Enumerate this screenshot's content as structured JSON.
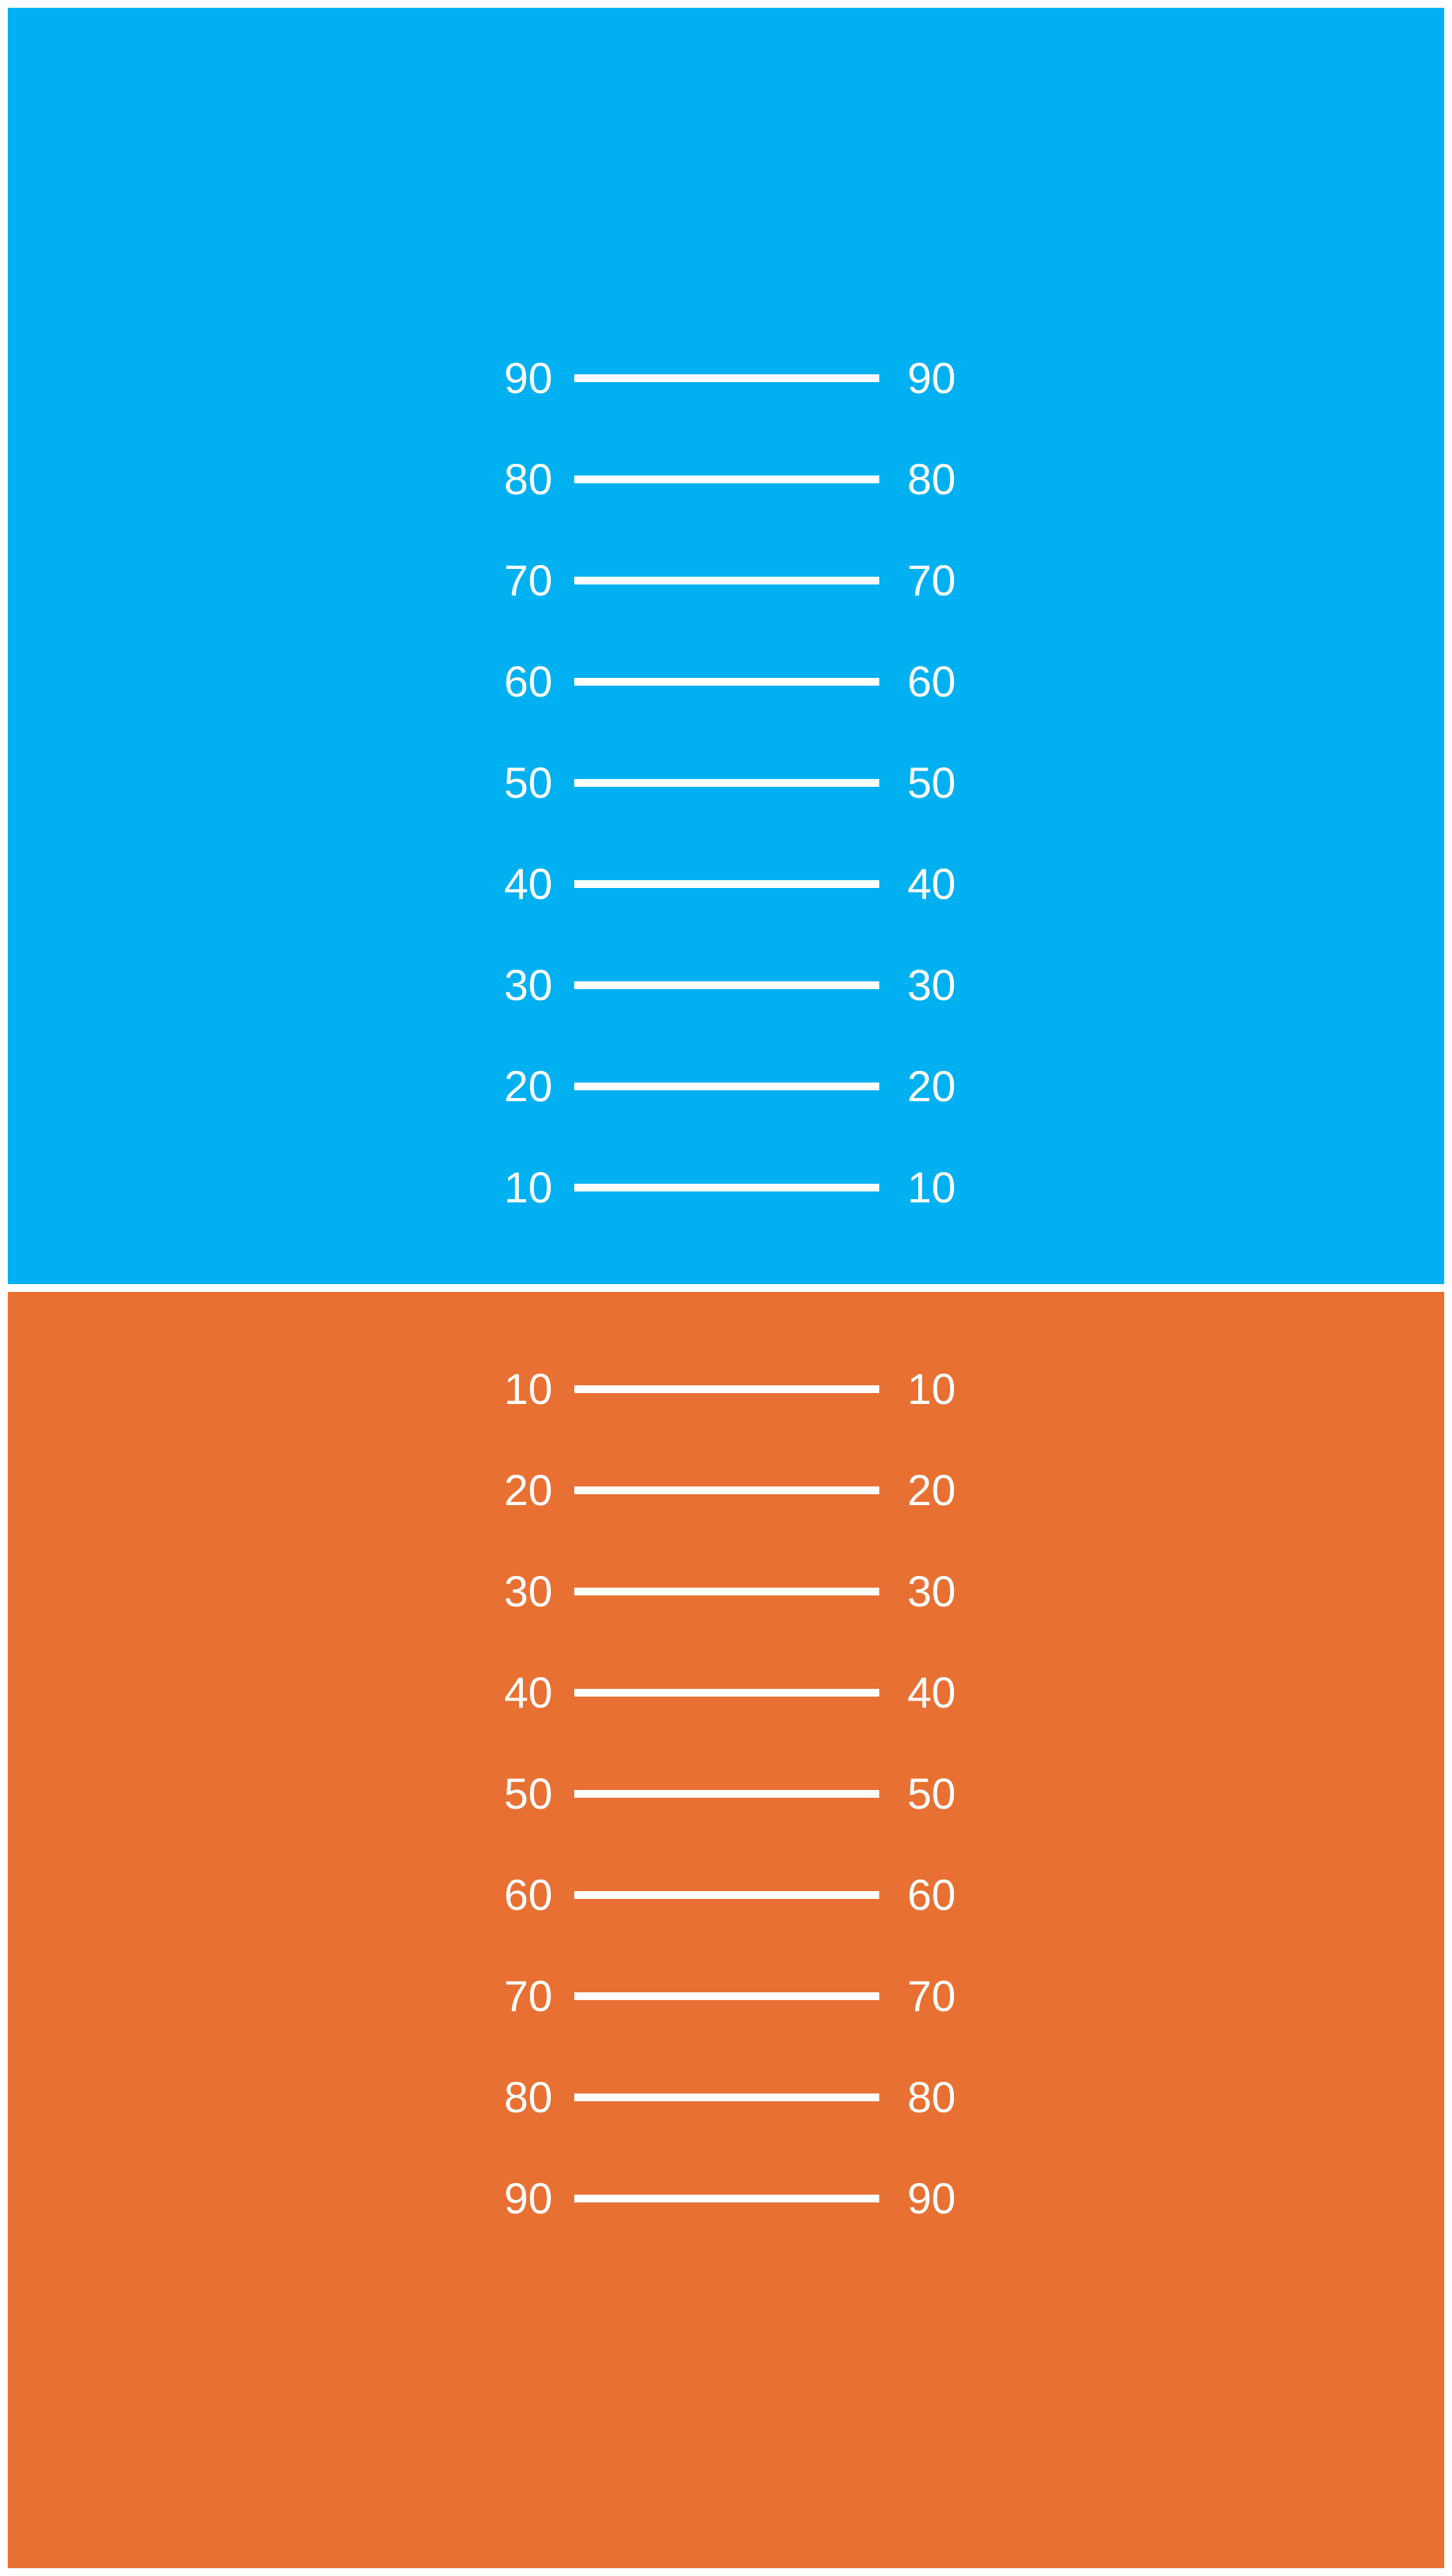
{
  "colors": {
    "background": "#ffffff",
    "sky": "#00b0f0",
    "ground": "#e87033",
    "markings": "#ffffff"
  },
  "sky_panel": {
    "rungs": [
      {
        "value": "90",
        "left_label": "90",
        "right_label": "90"
      },
      {
        "value": "80",
        "left_label": "80",
        "right_label": "80"
      },
      {
        "value": "70",
        "left_label": "70",
        "right_label": "70"
      },
      {
        "value": "60",
        "left_label": "60",
        "right_label": "60"
      },
      {
        "value": "50",
        "left_label": "50",
        "right_label": "50"
      },
      {
        "value": "40",
        "left_label": "40",
        "right_label": "40"
      },
      {
        "value": "30",
        "left_label": "30",
        "right_label": "30"
      },
      {
        "value": "20",
        "left_label": "20",
        "right_label": "20"
      },
      {
        "value": "10",
        "left_label": "10",
        "right_label": "10"
      }
    ]
  },
  "ground_panel": {
    "rungs": [
      {
        "value": "10",
        "left_label": "10",
        "right_label": "10"
      },
      {
        "value": "20",
        "left_label": "20",
        "right_label": "20"
      },
      {
        "value": "30",
        "left_label": "30",
        "right_label": "30"
      },
      {
        "value": "40",
        "left_label": "40",
        "right_label": "40"
      },
      {
        "value": "50",
        "left_label": "50",
        "right_label": "50"
      },
      {
        "value": "60",
        "left_label": "60",
        "right_label": "60"
      },
      {
        "value": "70",
        "left_label": "70",
        "right_label": "70"
      },
      {
        "value": "80",
        "left_label": "80",
        "right_label": "80"
      },
      {
        "value": "90",
        "left_label": "90",
        "right_label": "90"
      }
    ]
  }
}
